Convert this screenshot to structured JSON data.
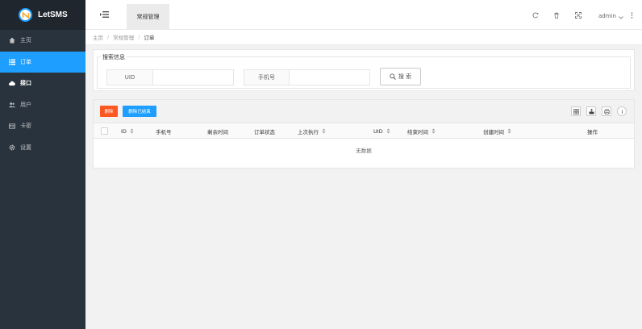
{
  "app": {
    "name": "LetSMS"
  },
  "sidebar": {
    "items": [
      {
        "label": "主页",
        "icon": "home-icon"
      },
      {
        "label": "订单",
        "icon": "list-icon",
        "active": true
      },
      {
        "label": "接口",
        "icon": "cloud-icon"
      },
      {
        "label": "用户",
        "icon": "users-icon"
      },
      {
        "label": "卡密",
        "icon": "card-icon"
      },
      {
        "label": "设置",
        "icon": "gear-icon"
      }
    ]
  },
  "header": {
    "tab_label": "常规管理",
    "user": "admin",
    "icons": [
      "refresh-icon",
      "trash-icon",
      "fullscreen-icon"
    ]
  },
  "breadcrumb": {
    "home": "主页",
    "section": "常规管理",
    "current": "订单"
  },
  "search": {
    "legend": "搜索信息",
    "uid_label": "UID",
    "uid_value": "",
    "phone_label": "手机号",
    "phone_value": "",
    "button_label": "搜 索"
  },
  "toolbar": {
    "delete_label": "删除",
    "delete_finished_label": "删除已结束",
    "tools": [
      "columns-icon",
      "export-icon",
      "print-icon",
      "info-icon"
    ]
  },
  "table": {
    "columns": [
      "ID",
      "手机号",
      "剩余时间",
      "订单状态",
      "上次执行",
      "UID",
      "结束时间",
      "创建时间",
      "操作"
    ],
    "empty_text": "无数据"
  },
  "colors": {
    "accent": "#1e9fff",
    "danger": "#ff5722",
    "sidebar": "#28333e"
  }
}
